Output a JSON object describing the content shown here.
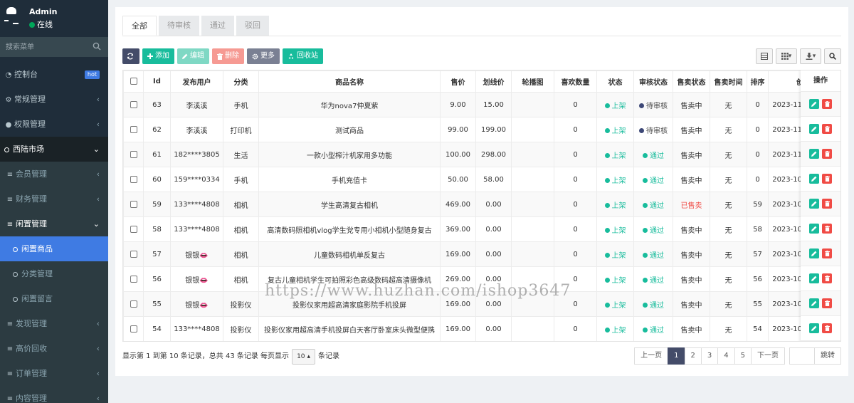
{
  "sidebar": {
    "user_name": "Admin",
    "user_status": "在线",
    "search_placeholder": "搜索菜单",
    "items": [
      {
        "label": "控制台",
        "badge": "hot"
      },
      {
        "label": "常规管理"
      },
      {
        "label": "权限管理"
      },
      {
        "label": "西陆市场"
      },
      {
        "label": "会员管理"
      },
      {
        "label": "财务管理"
      },
      {
        "label": "闲置管理"
      },
      {
        "label": "闲置商品"
      },
      {
        "label": "分类管理"
      },
      {
        "label": "闲置留言"
      },
      {
        "label": "发现管理"
      },
      {
        "label": "高价回收"
      },
      {
        "label": "订单管理"
      },
      {
        "label": "内容管理"
      }
    ]
  },
  "tabs": [
    "全部",
    "待审核",
    "通过",
    "驳回"
  ],
  "toolbar": {
    "add": "添加",
    "edit": "编辑",
    "delete": "删除",
    "more": "更多",
    "recycle": "回收站"
  },
  "table": {
    "columns": [
      "Id",
      "发布用户",
      "分类",
      "商品名称",
      "售价",
      "划线价",
      "轮播图",
      "喜欢数量",
      "状态",
      "审核状态",
      "售卖状态",
      "售卖时间",
      "排序",
      "创",
      "操作"
    ],
    "rows": [
      {
        "id": "63",
        "user": "李溪溪",
        "cat": "手机",
        "name": "华为nova7仲夏紫",
        "price": "9.00",
        "orig": "15.00",
        "likes": "0",
        "status": "上架",
        "audit": "待审核",
        "sale": "售卖中",
        "sale_time": "无",
        "sort": "0",
        "created": "2023-11"
      },
      {
        "id": "62",
        "user": "李溪溪",
        "cat": "打印机",
        "name": "测试商品",
        "price": "99.00",
        "orig": "199.00",
        "likes": "0",
        "status": "上架",
        "audit": "待审核",
        "sale": "售卖中",
        "sale_time": "无",
        "sort": "0",
        "created": "2023-11"
      },
      {
        "id": "61",
        "user": "182****3805",
        "cat": "生活",
        "name": "一款小型榨汁机家用多功能",
        "price": "100.00",
        "orig": "298.00",
        "likes": "0",
        "status": "上架",
        "audit": "通过",
        "sale": "售卖中",
        "sale_time": "无",
        "sort": "0",
        "created": "2023-11"
      },
      {
        "id": "60",
        "user": "159****0334",
        "cat": "手机",
        "name": "手机充值卡",
        "price": "50.00",
        "orig": "58.00",
        "likes": "0",
        "status": "上架",
        "audit": "通过",
        "sale": "售卖中",
        "sale_time": "无",
        "sort": "0",
        "created": "2023-10"
      },
      {
        "id": "59",
        "user": "133****4808",
        "cat": "相机",
        "name": "学生高清复古相机",
        "price": "469.00",
        "orig": "0.00",
        "likes": "0",
        "status": "上架",
        "audit": "通过",
        "sale": "已售卖",
        "sale_time": "无",
        "sort": "59",
        "created": "2023-10"
      },
      {
        "id": "58",
        "user": "133****4808",
        "cat": "相机",
        "name": "高清数码照相机vlog学生党专用小相机小型随身复古",
        "price": "369.00",
        "orig": "0.00",
        "likes": "0",
        "status": "上架",
        "audit": "通过",
        "sale": "售卖中",
        "sale_time": "无",
        "sort": "58",
        "created": "2023-10"
      },
      {
        "id": "57",
        "user": "银银👄",
        "cat": "相机",
        "name": "儿童数码相机单反复古",
        "price": "169.00",
        "orig": "0.00",
        "likes": "0",
        "status": "上架",
        "audit": "通过",
        "sale": "售卖中",
        "sale_time": "无",
        "sort": "57",
        "created": "2023-10"
      },
      {
        "id": "56",
        "user": "银银👄",
        "cat": "相机",
        "name": "复古儿童相机学生可拍照彩色高级数码超高清摄像机",
        "price": "269.00",
        "orig": "0.00",
        "likes": "0",
        "status": "上架",
        "audit": "通过",
        "sale": "售卖中",
        "sale_time": "无",
        "sort": "56",
        "created": "2023-10"
      },
      {
        "id": "55",
        "user": "银银👄",
        "cat": "投影仪",
        "name": "投影仪家用超高清家庭影院手机投屏",
        "price": "169.00",
        "orig": "0.00",
        "likes": "0",
        "status": "上架",
        "audit": "通过",
        "sale": "售卖中",
        "sale_time": "无",
        "sort": "55",
        "created": "2023-10"
      },
      {
        "id": "54",
        "user": "133****4808",
        "cat": "投影仪",
        "name": "投影仪家用超高清手机投屏白天客厅卧室床头微型便携",
        "price": "169.00",
        "orig": "0.00",
        "likes": "0",
        "status": "上架",
        "audit": "通过",
        "sale": "售卖中",
        "sale_time": "无",
        "sort": "54",
        "created": "2023-10"
      }
    ]
  },
  "footer": {
    "info_prefix": "显示第 1 到第 10 条记录，总共 43 条记录 每页显示",
    "page_size": "10",
    "info_suffix": "条记录"
  },
  "pager": {
    "prev": "上一页",
    "pages": [
      "1",
      "2",
      "3",
      "4",
      "5"
    ],
    "next": "下一页",
    "jump": "跳转"
  },
  "watermark": "https://www.huzhan.com/ishop3647",
  "colors": {
    "sidebar_bg": "#1f2d3a",
    "accent": "#3f7be3",
    "success": "#18bc9c",
    "danger": "#f04b45"
  }
}
